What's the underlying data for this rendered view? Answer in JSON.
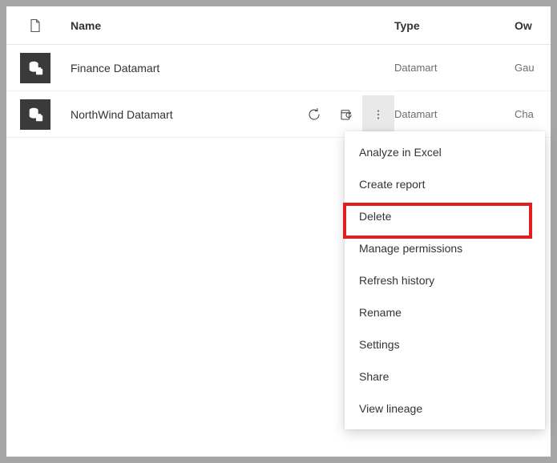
{
  "columns": {
    "name": "Name",
    "type": "Type",
    "owner": "Ow"
  },
  "rows": [
    {
      "name": "Finance Datamart",
      "type": "Datamart",
      "owner": "Gau"
    },
    {
      "name": "NorthWind Datamart",
      "type": "Datamart",
      "owner": "Cha"
    }
  ],
  "contextMenu": {
    "items": [
      "Analyze in Excel",
      "Create report",
      "Delete",
      "Manage permissions",
      "Refresh history",
      "Rename",
      "Settings",
      "Share",
      "View lineage"
    ],
    "highlightedIndex": 2
  }
}
